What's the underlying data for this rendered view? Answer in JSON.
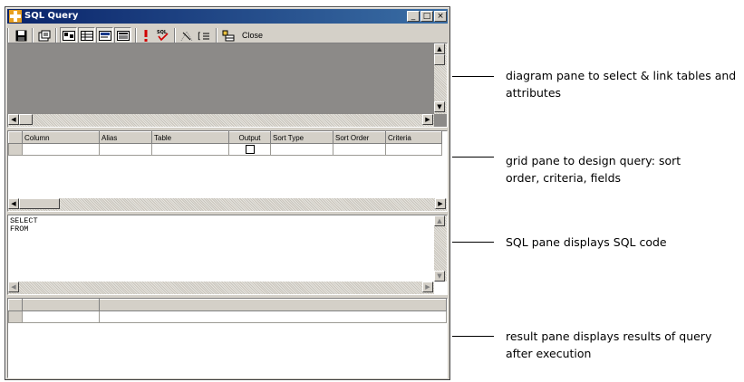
{
  "window": {
    "title": "SQL Query",
    "minimize_glyph": "_",
    "maximize_glyph": "□",
    "close_glyph": "×"
  },
  "toolbar": {
    "close_label": "Close"
  },
  "grid_pane": {
    "columns": [
      "Column",
      "Alias",
      "Table",
      "Output",
      "Sort Type",
      "Sort Order",
      "Criteria"
    ]
  },
  "sql_pane": {
    "code": "SELECT\nFROM"
  },
  "annotations": {
    "diagram": "diagram pane to select & link tables and attributes",
    "grid": "grid pane to design query: sort order, criteria, fields",
    "sql": "SQL pane displays SQL code",
    "result": "result pane displays results of query after execution"
  },
  "colors": {
    "title_bar": "#0a246a",
    "window_face": "#d4d0c8",
    "diagram_background": "#8c8a88"
  }
}
